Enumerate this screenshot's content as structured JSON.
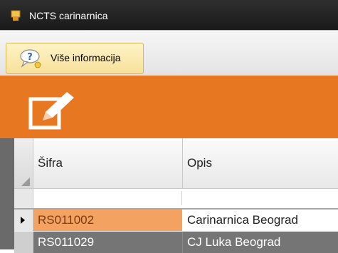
{
  "window": {
    "title": "NCTS carinarnica",
    "icon": "app-icon"
  },
  "toolbar": {
    "info_button_label": "Više informacija",
    "info_button_icon": "help-bubble-icon"
  },
  "banner": {
    "color": "#e87722",
    "icon": "edit-icon"
  },
  "grid": {
    "columns": [
      "Šifra",
      "Opis"
    ],
    "rows": [
      {
        "sifra": "RS011002",
        "opis": "Carinarnica Beograd",
        "selected": true
      },
      {
        "sifra": "RS011029",
        "opis": "CJ Luka Beograd",
        "selected": false
      }
    ]
  },
  "colors": {
    "selected_cell": "#f4a261",
    "row_dark": "#757575"
  }
}
